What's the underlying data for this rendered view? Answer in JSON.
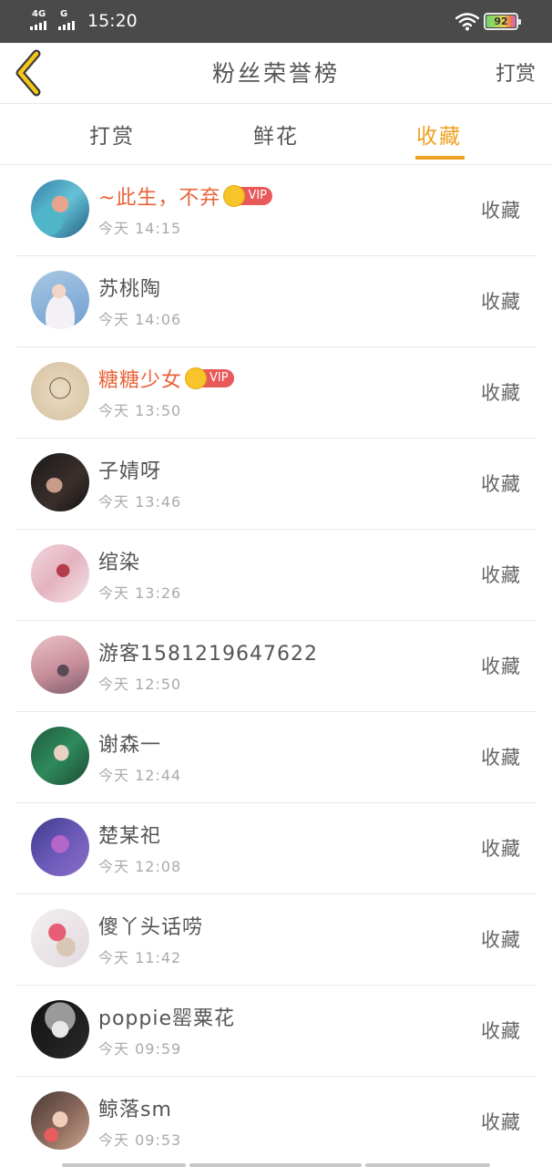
{
  "status_bar": {
    "sim1_label": "4G",
    "sim2_label": "G",
    "time": "15:20",
    "battery": "92"
  },
  "header": {
    "title": "粉丝荣誉榜",
    "action": "打赏"
  },
  "tabs": [
    {
      "label": "打赏",
      "active": false
    },
    {
      "label": "鲜花",
      "active": false
    },
    {
      "label": "收藏",
      "active": true
    }
  ],
  "colors": {
    "accent": "#f0a020",
    "vip_name": "#e8643a",
    "vip_badge": "#e85a5a",
    "crown": "#f7c52a",
    "status_bar_bg": "#4a4a4a"
  },
  "vip_label": "VIP",
  "fans": [
    {
      "name": "~此生，不弃",
      "time": "今天 14:15",
      "vip": true,
      "action": "收藏"
    },
    {
      "name": "苏桃陶",
      "time": "今天 14:06",
      "vip": false,
      "action": "收藏"
    },
    {
      "name": "糖糖少女",
      "time": "今天 13:50",
      "vip": true,
      "action": "收藏"
    },
    {
      "name": "子婧呀",
      "time": "今天 13:46",
      "vip": false,
      "action": "收藏"
    },
    {
      "name": "绾染",
      "time": "今天 13:26",
      "vip": false,
      "action": "收藏"
    },
    {
      "name": "游客1581219647622",
      "time": "今天 12:50",
      "vip": false,
      "action": "收藏"
    },
    {
      "name": "谢森一",
      "time": "今天 12:44",
      "vip": false,
      "action": "收藏"
    },
    {
      "name": "楚某祀",
      "time": "今天 12:08",
      "vip": false,
      "action": "收藏"
    },
    {
      "name": "傻丫头话唠",
      "time": "今天 11:42",
      "vip": false,
      "action": "收藏"
    },
    {
      "name": "poppie罂粟花",
      "time": "今天 09:59",
      "vip": false,
      "action": "收藏"
    },
    {
      "name": "鲸落sm",
      "time": "今天 09:53",
      "vip": false,
      "action": "收藏"
    }
  ]
}
